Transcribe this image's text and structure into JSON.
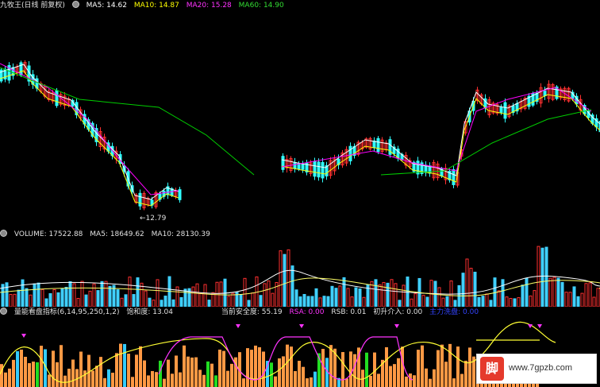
{
  "price_panel": {
    "title": "九牧王(日线 前复权)",
    "ma5": "MA5: 14.62",
    "ma10": "MA10: 14.87",
    "ma20": "MA20: 15.28",
    "ma60": "MA60: 14.90",
    "low_label": "←12.79",
    "colors": {
      "ma5": "#ffffff",
      "ma10": "#ffff00",
      "ma20": "#ff00ff",
      "ma60": "#00cc00",
      "up": "#ff3030",
      "down": "#30ffff"
    }
  },
  "volume_panel": {
    "volume": "VOLUME: 17522.88",
    "ma5": "MA5: 18649.62",
    "ma10": "MA10: 28130.39"
  },
  "indicator_panel": {
    "name": "量能看盘指标(6,14,95,250,1,2)",
    "saturation": "饱和度: 13.04",
    "safety": "当前安全度: 55.19",
    "rsa": "RSA: 0.00",
    "rsb": "RSB: 0.01",
    "entry": "初升介入: 0.00",
    "main_wash": "主力洗盘: 0.00"
  },
  "watermark": {
    "logo_text": "脚",
    "url": "www.7gpzb.com"
  }
}
